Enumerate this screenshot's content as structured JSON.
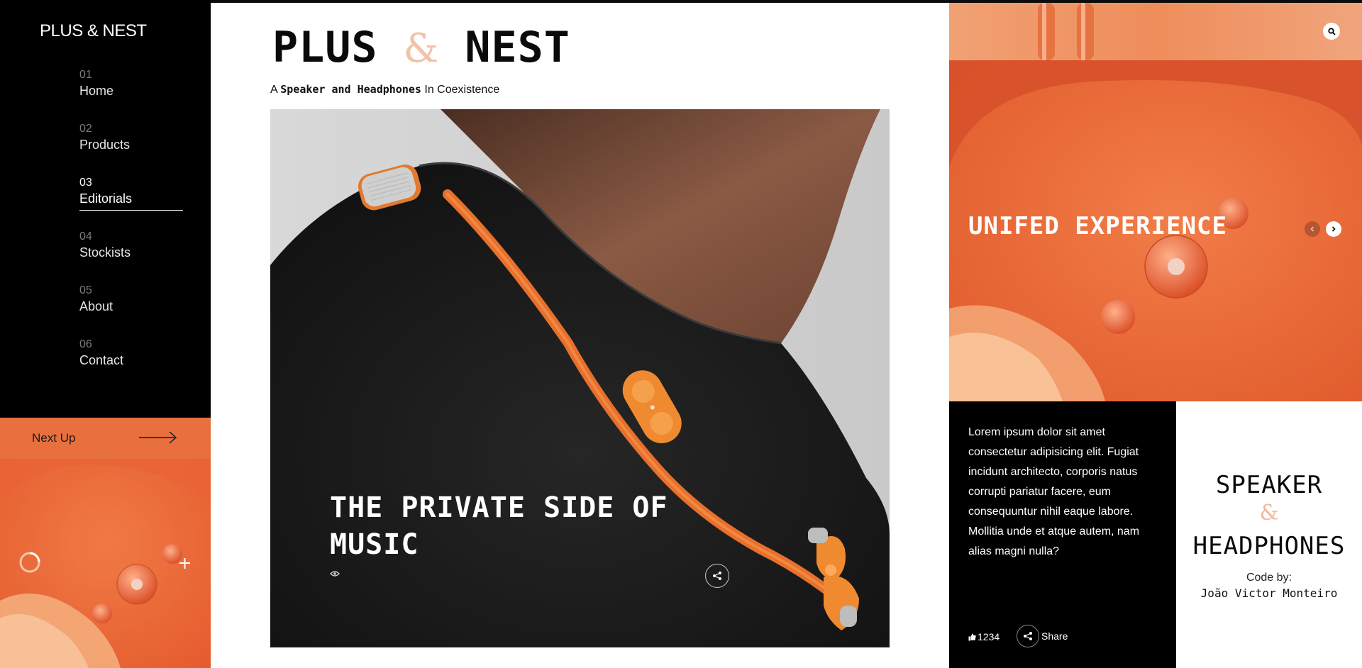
{
  "brand": "PLUS & NEST",
  "nav": [
    {
      "num": "01",
      "label": "Home"
    },
    {
      "num": "02",
      "label": "Products"
    },
    {
      "num": "03",
      "label": "Editorials"
    },
    {
      "num": "04",
      "label": "Stockists"
    },
    {
      "num": "05",
      "label": "About"
    },
    {
      "num": "06",
      "label": "Contact"
    }
  ],
  "nav_active": "Editorials",
  "next_up": {
    "label": "Next Up"
  },
  "header": {
    "title_left": "PLUS",
    "title_amp": "&",
    "title_right": "NEST",
    "subtitle_prefix": "A",
    "subtitle_bold": "Speaker and Headphones",
    "subtitle_suffix": "In Coexistence"
  },
  "hero": {
    "title": "THE PRIVATE SIDE OF MUSIC"
  },
  "feature": {
    "title": "UNIFED EXPERIENCE"
  },
  "article": {
    "body": "Lorem ipsum dolor sit amet consectetur adipisicing elit. Fugiat incidunt architecto, corporis natus corrupti pariatur facere, eum consequuntur nihil eaque labore. Mollitia unde et atque autem, nam alias magni nulla?",
    "likes": "1234",
    "share_label": "Share"
  },
  "credits": {
    "line1": "SPEAKER",
    "amp": "&",
    "line2": "HEADPHONES",
    "code_by": "Code by:",
    "author": "João Victor Monteiro"
  },
  "colors": {
    "accent": "#e8703f",
    "accent_dark": "#e65f33",
    "amp_tint": "#f0c2a8",
    "sidebar_bg": "#000000"
  },
  "icons": [
    "search-icon",
    "arrow-right-icon",
    "chevron-left-icon",
    "chevron-right-icon",
    "share-icon",
    "eye-icon",
    "thumbs-up-icon",
    "plus-icon",
    "loader-icon"
  ]
}
